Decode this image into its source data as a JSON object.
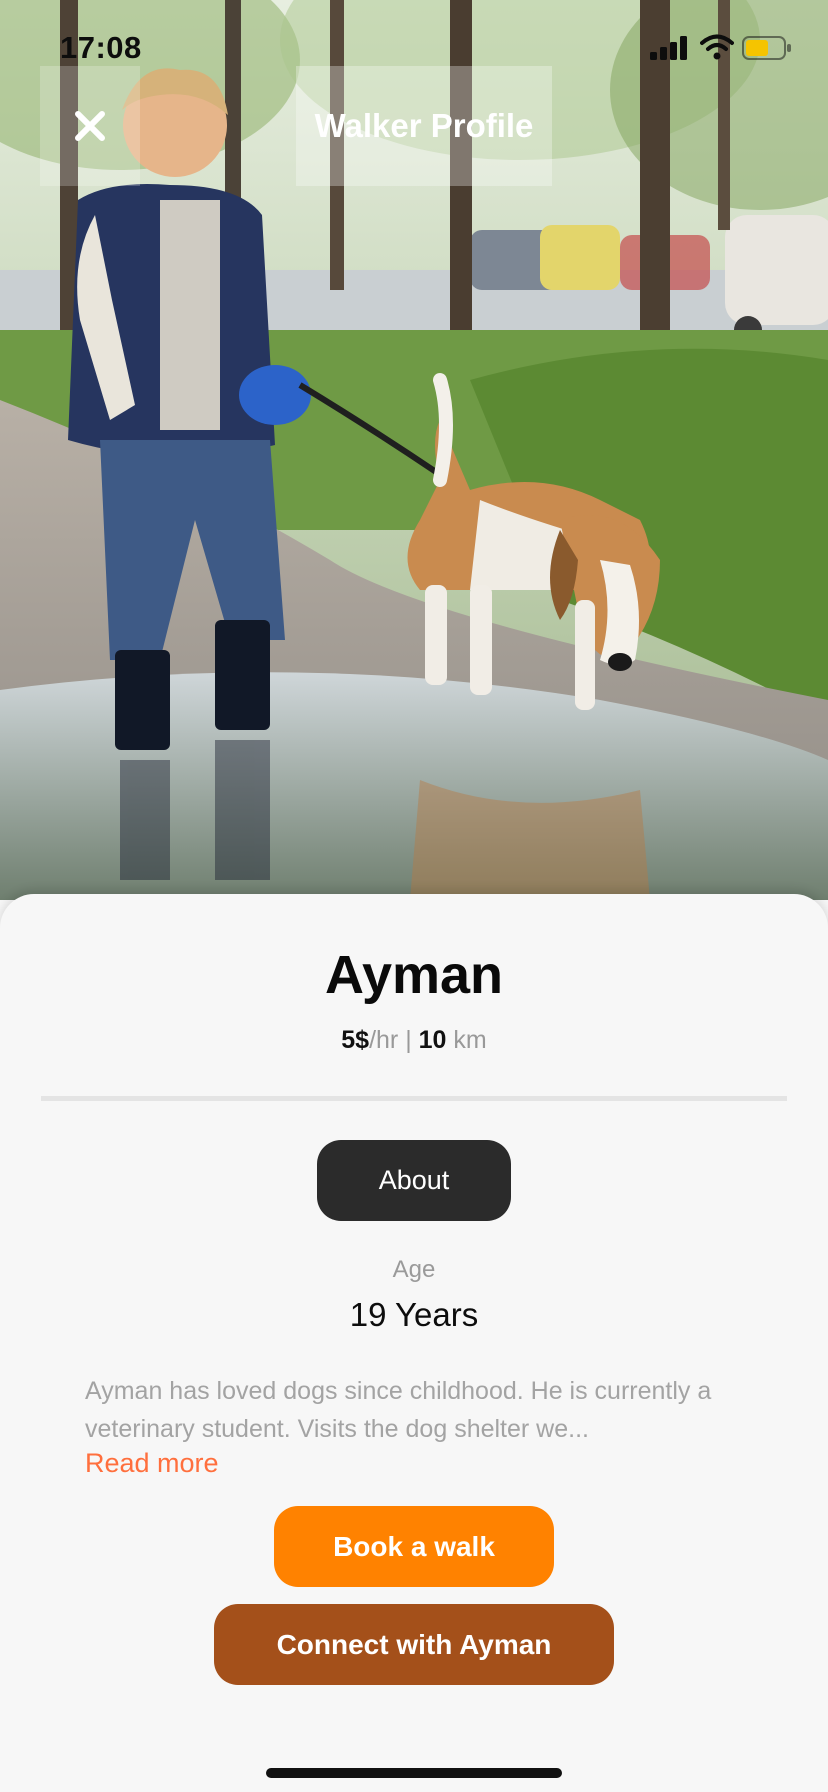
{
  "status_bar": {
    "time": "17:08"
  },
  "header": {
    "title": "Walker Profile",
    "close_icon": "close-icon"
  },
  "hero_image": {
    "subject": "boy-walking-beagle-photo"
  },
  "profile": {
    "name": "Ayman",
    "rate_value": "5$",
    "rate_unit": "/hr",
    "separator": " | ",
    "distance_value": "10",
    "distance_unit": " km",
    "about_tab_label": "About",
    "age_label": "Age",
    "age_value": "19 Years",
    "bio": "Ayman has loved dogs since childhood. He is currently a veterinary student. Visits the dog shelter we...",
    "read_more_label": "Read more"
  },
  "actions": {
    "book_label": "Book a walk",
    "connect_label": "Connect with Ayman"
  },
  "colors": {
    "accent_orange": "#ff8200",
    "brown_button": "#a4501a",
    "read_more": "#ff6f3d",
    "tab_dark": "#2b2b2b"
  }
}
